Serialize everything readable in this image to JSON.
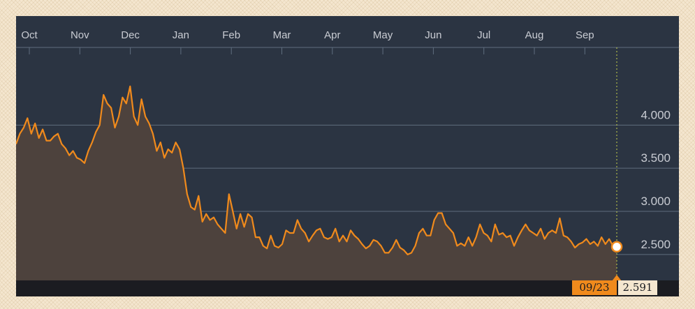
{
  "chart_data": {
    "type": "area",
    "title": "",
    "xlabel": "",
    "ylabel": "",
    "x_tick_labels": [
      "Oct",
      "Nov",
      "Dec",
      "Jan",
      "Feb",
      "Mar",
      "Apr",
      "May",
      "Jun",
      "Jul",
      "Aug",
      "Sep"
    ],
    "y_tick_labels": [
      "4.000",
      "3.500",
      "3.000",
      "2.500"
    ],
    "y_ticks": [
      4.0,
      3.5,
      3.0,
      2.5
    ],
    "ylim": [
      2.2,
      4.9
    ],
    "grid": true,
    "colors": {
      "line": "#f08a1c",
      "area": "#4d423d",
      "background": "#2b3442",
      "gridline": "#5f6d7e",
      "axis_text": "#c9ccd3",
      "crosshair": "#c8d34a"
    },
    "series": [
      {
        "values": [
          3.78,
          3.9,
          3.97,
          4.08,
          3.9,
          4.02,
          3.85,
          3.95,
          3.82,
          3.82,
          3.87,
          3.9,
          3.78,
          3.73,
          3.65,
          3.7,
          3.62,
          3.6,
          3.56,
          3.7,
          3.8,
          3.92,
          4.0,
          4.35,
          4.25,
          4.2,
          3.97,
          4.1,
          4.32,
          4.25,
          4.45,
          4.1,
          4.0,
          4.3,
          4.1,
          4.02,
          3.9,
          3.7,
          3.8,
          3.62,
          3.72,
          3.68,
          3.8,
          3.72,
          3.5,
          3.2,
          3.05,
          3.02,
          3.18,
          2.88,
          2.97,
          2.9,
          2.93,
          2.85,
          2.8,
          2.75,
          3.2,
          3.0,
          2.8,
          2.97,
          2.82,
          2.97,
          2.93,
          2.7,
          2.7,
          2.6,
          2.57,
          2.72,
          2.6,
          2.58,
          2.62,
          2.78,
          2.75,
          2.75,
          2.9,
          2.8,
          2.75,
          2.65,
          2.72,
          2.78,
          2.8,
          2.7,
          2.68,
          2.7,
          2.8,
          2.65,
          2.72,
          2.65,
          2.78,
          2.72,
          2.68,
          2.62,
          2.57,
          2.6,
          2.67,
          2.65,
          2.6,
          2.52,
          2.52,
          2.58,
          2.67,
          2.58,
          2.55,
          2.5,
          2.52,
          2.6,
          2.75,
          2.8,
          2.72,
          2.72,
          2.9,
          2.98,
          2.98,
          2.85,
          2.8,
          2.75,
          2.6,
          2.63,
          2.6,
          2.7,
          2.6,
          2.7,
          2.85,
          2.75,
          2.72,
          2.65,
          2.85,
          2.73,
          2.75,
          2.7,
          2.72,
          2.6,
          2.7,
          2.78,
          2.85,
          2.78,
          2.75,
          2.72,
          2.8,
          2.68,
          2.75,
          2.78,
          2.75,
          2.92,
          2.72,
          2.7,
          2.65,
          2.58,
          2.62,
          2.64,
          2.68,
          2.62,
          2.65,
          2.6,
          2.7,
          2.62,
          2.68,
          2.6,
          2.59
        ]
      }
    ],
    "last_point": {
      "date": "09/23",
      "value": "2.591"
    }
  }
}
